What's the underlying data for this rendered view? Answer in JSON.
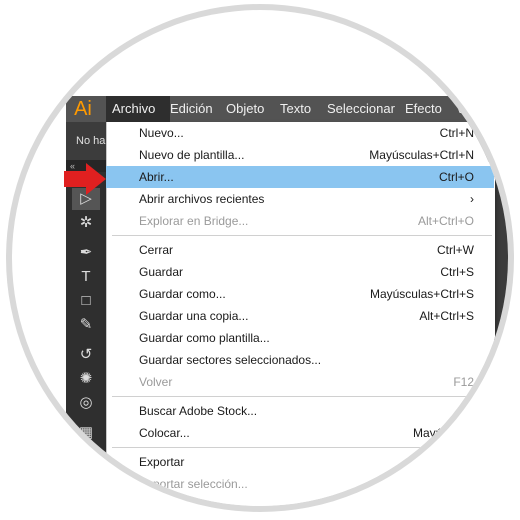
{
  "app": {
    "logo": "Ai"
  },
  "menubar": {
    "items": [
      {
        "label": "Archivo",
        "active": true
      },
      {
        "label": "Edición"
      },
      {
        "label": "Objeto"
      },
      {
        "label": "Texto"
      },
      {
        "label": "Seleccionar"
      },
      {
        "label": "Efecto"
      },
      {
        "label": "V"
      }
    ]
  },
  "subbar": {
    "text": "No ha"
  },
  "toolbar": {
    "collapse": "«",
    "tools": [
      {
        "name": "direct-selection-tool",
        "glyph": "▷",
        "selected": true
      },
      {
        "name": "magic-wand-tool",
        "glyph": "✲"
      },
      {
        "name": "pen-tool",
        "glyph": "✒"
      },
      {
        "name": "type-tool",
        "glyph": "T"
      },
      {
        "name": "rectangle-tool",
        "glyph": "□"
      },
      {
        "name": "paintbrush-tool",
        "glyph": "✎"
      },
      {
        "name": "rotate-tool",
        "glyph": "↺"
      },
      {
        "name": "puppet-warp-tool",
        "glyph": "✺"
      },
      {
        "name": "shape-builder-tool",
        "glyph": "◎"
      },
      {
        "name": "mesh-tool",
        "glyph": "▦"
      }
    ]
  },
  "menu": {
    "items": [
      {
        "label": "Nuevo...",
        "shortcut": "Ctrl+N"
      },
      {
        "label": "Nuevo de plantilla...",
        "shortcut": "Mayúsculas+Ctrl+N"
      },
      {
        "label": "Abrir...",
        "shortcut": "Ctrl+O",
        "highlighted": true
      },
      {
        "label": "Abrir archivos recientes",
        "shortcut": "›"
      },
      {
        "label": "Explorar en Bridge...",
        "shortcut": "Alt+Ctrl+O",
        "disabled": true
      },
      {
        "label": "Cerrar",
        "shortcut": "Ctrl+W"
      },
      {
        "label": "Guardar",
        "shortcut": "Ctrl+S"
      },
      {
        "label": "Guardar como...",
        "shortcut": "Mayúsculas+Ctrl+S"
      },
      {
        "label": "Guardar una copia...",
        "shortcut": "Alt+Ctrl+S"
      },
      {
        "label": "Guardar como plantilla...",
        "shortcut": ""
      },
      {
        "label": "Guardar sectores seleccionados...",
        "shortcut": ""
      },
      {
        "label": "Volver",
        "shortcut": "F12",
        "disabled": true
      },
      {
        "label": "Buscar Adobe Stock...",
        "shortcut": ""
      },
      {
        "label": "Colocar...",
        "shortcut": "Mayúsculas+C"
      },
      {
        "label": "Exportar",
        "shortcut": ""
      },
      {
        "label": "Exportar selección...",
        "shortcut": "",
        "disabled": true
      }
    ]
  },
  "colors": {
    "highlight": "#8ac5f0",
    "accent_arrow": "#e02020",
    "logo": "#ff9a00"
  }
}
